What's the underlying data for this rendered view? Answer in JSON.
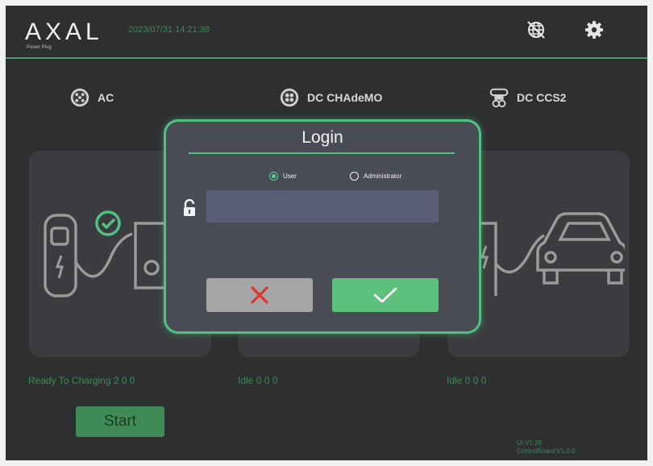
{
  "header": {
    "logo_text": "AXAL",
    "logo_subtext": "Power Plug",
    "datetime": "2023/07/31 14:21:38",
    "icons": [
      "globe-icon",
      "gear-icon"
    ]
  },
  "connectors": [
    {
      "label": "AC",
      "icon": "ac-type2-connector-icon",
      "status": "Ready To Charging 2 0 0"
    },
    {
      "label": "DC CHAdeMO",
      "icon": "chademo-connector-icon",
      "status": "Idle 0 0 0"
    },
    {
      "label": "DC CCS2",
      "icon": "ccs2-connector-icon",
      "status": "Idle 0 0 0"
    }
  ],
  "start_button": {
    "label": "Start"
  },
  "version": {
    "ui": "UI:V1.26",
    "control_board": "ControlBoard:V1.0.0"
  },
  "login_dialog": {
    "title": "Login",
    "radio_user": "User",
    "radio_admin": "Administrator",
    "selected_role": "User",
    "password_value": "",
    "cancel_icon": "x-icon",
    "confirm_icon": "check-icon"
  },
  "colors": {
    "accent_green": "#4fc282",
    "status_green": "#3c8a55",
    "cancel_red": "#e0352b",
    "background": "#2e2f31"
  }
}
